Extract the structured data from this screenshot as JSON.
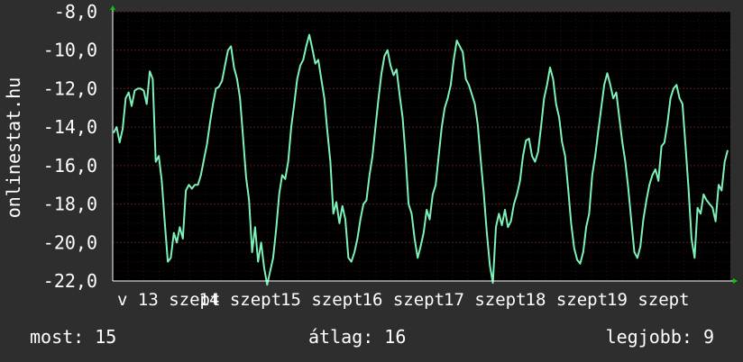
{
  "chart_data": {
    "type": "line",
    "ylabel": "onlinestat.hu",
    "ylim": [
      -22.0,
      -8.0
    ],
    "yticks": [
      "-8,0",
      "-10,0",
      "-12,0",
      "-14,0",
      "-16,0",
      "-18,0",
      "-20,0",
      "-22,0"
    ],
    "ytick_values": [
      -8,
      -10,
      -12,
      -14,
      -16,
      -18,
      -20,
      -22
    ],
    "xtick_labels": [
      "v 13 szept",
      "14 szept",
      "15 szept",
      "16 szept",
      "17 szept",
      "18 szept",
      "19 szept"
    ],
    "grid": true,
    "colors": {
      "background": "#2e2e2e",
      "plot_background": "#000000",
      "grid": "#5a2020",
      "line": "#7cf2b8",
      "axis": "#ffffff",
      "arrow": "#00cc00"
    },
    "series": [
      {
        "values": [
          -14.3,
          -14.0,
          -14.8,
          -14.1,
          -12.5,
          -12.2,
          -12.9,
          -12.1,
          -12.0,
          -12.0,
          -12.1,
          -12.8,
          -11.1,
          -11.5,
          -15.8,
          -15.5,
          -16.8,
          -19.0,
          -21.0,
          -20.8,
          -19.5,
          -20.0,
          -19.2,
          -19.8,
          -17.3,
          -17.0,
          -17.2,
          -17.0,
          -17.0,
          -16.5,
          -15.7,
          -14.9,
          -13.8,
          -12.8,
          -12.0,
          -11.9,
          -11.6,
          -10.8,
          -10.0,
          -9.8,
          -10.9,
          -11.5,
          -12.5,
          -14.5,
          -16.6,
          -17.8,
          -20.5,
          -19.2,
          -21.0,
          -20.0,
          -21.3,
          -22.2,
          -21.5,
          -20.8,
          -19.3,
          -17.5,
          -16.5,
          -16.7,
          -15.8,
          -14.0,
          -12.8,
          -11.5,
          -10.8,
          -10.5,
          -9.8,
          -9.2,
          -9.9,
          -10.7,
          -10.5,
          -11.5,
          -12.5,
          -14.2,
          -15.8,
          -18.5,
          -17.9,
          -19.0,
          -18.1,
          -18.8,
          -20.8,
          -21.0,
          -20.5,
          -19.8,
          -18.8,
          -18.0,
          -17.8,
          -16.5,
          -15.5,
          -14.0,
          -12.5,
          -11.2,
          -10.3,
          -10.0,
          -10.8,
          -11.3,
          -11.0,
          -12.3,
          -13.5,
          -15.5,
          -18.0,
          -18.5,
          -19.8,
          -20.8,
          -20.2,
          -19.5,
          -18.3,
          -18.8,
          -17.5,
          -17.0,
          -15.5,
          -14.0,
          -13.0,
          -12.5,
          -11.8,
          -10.5,
          -9.5,
          -9.8,
          -10.1,
          -11.5,
          -11.8,
          -12.3,
          -12.8,
          -13.9,
          -15.8,
          -17.5,
          -19.5,
          -21.2,
          -22.1,
          -19.2,
          -18.5,
          -19.1,
          -18.3,
          -19.2,
          -18.9,
          -18.0,
          -17.5,
          -16.8,
          -15.5,
          -14.7,
          -14.6,
          -15.5,
          -15.8,
          -15.3,
          -14.0,
          -12.5,
          -11.8,
          -10.9,
          -11.5,
          -12.8,
          -13.5,
          -14.8,
          -15.5,
          -17.2,
          -19.0,
          -20.3,
          -20.9,
          -21.1,
          -20.5,
          -19.2,
          -18.5,
          -16.5,
          -15.5,
          -14.2,
          -13.0,
          -11.8,
          -11.2,
          -11.8,
          -12.5,
          -12.2,
          -13.5,
          -14.8,
          -15.8,
          -17.2,
          -18.9,
          -20.5,
          -20.8,
          -20.2,
          -18.8,
          -17.8,
          -17.0,
          -16.5,
          -16.2,
          -16.8,
          -15.0,
          -14.8,
          -13.8,
          -12.5,
          -12.0,
          -11.8,
          -12.5,
          -12.8,
          -15.0,
          -17.2,
          -19.8,
          -20.8,
          -18.2,
          -18.5,
          -17.5,
          -17.8,
          -18.0,
          -18.2,
          -18.9,
          -17.0,
          -17.3,
          -15.8,
          -15.2
        ]
      }
    ]
  },
  "stats": {
    "now": "most: 15",
    "avg": "átlag: 16",
    "best": "legjobb: 9"
  }
}
